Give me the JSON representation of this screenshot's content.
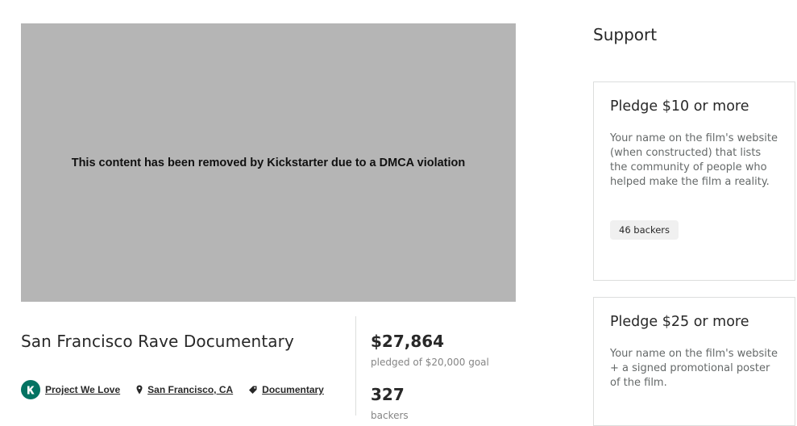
{
  "media": {
    "removed_message": "This content has been removed by Kickstarter due to a DMCA violation"
  },
  "project": {
    "title": "San Francisco Rave Documentary",
    "badge": "Project We Love",
    "location": "San Francisco, CA",
    "category": "Documentary"
  },
  "stats": {
    "pledged": "$27,864",
    "pledged_sub": "pledged of $20,000 goal",
    "backers": "327",
    "backers_label": "backers"
  },
  "support": {
    "title": "Support",
    "rewards": [
      {
        "title": "Pledge $10 or more",
        "description": "Your name on the film's website (when constructed) that lists the community of people who helped make the film a reality.",
        "backers": "46 backers"
      },
      {
        "title": "Pledge $25 or more",
        "description": "Your name on the film's website + a signed promotional poster of the film."
      }
    ]
  },
  "icons": {
    "badge": "kickstarter-k-icon",
    "location": "map-pin-icon",
    "category": "tag-icon"
  },
  "colors": {
    "badge_green": "#037362",
    "media_gray": "#b5b5b5"
  }
}
